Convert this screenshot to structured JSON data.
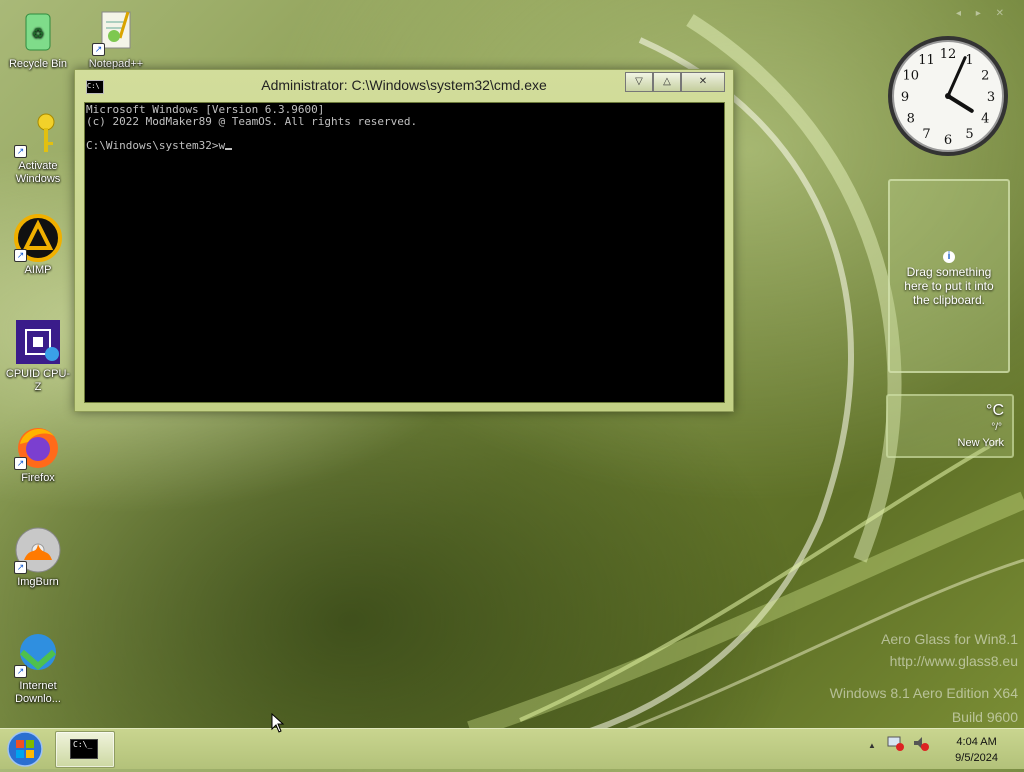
{
  "desktop_icons": [
    {
      "label": "Recycle Bin",
      "icon": "recycle-bin-icon"
    },
    {
      "label": "Notepad++",
      "icon": "notepad-plus-plus-icon"
    },
    {
      "label": "Activate Windows",
      "icon": "key-icon"
    },
    {
      "label": "AIMP",
      "icon": "aimp-icon"
    },
    {
      "label": "CPUID CPU-Z",
      "icon": "cpu-z-icon"
    },
    {
      "label": "Firefox",
      "icon": "firefox-icon"
    },
    {
      "label": "ImgBurn",
      "icon": "imgburn-icon"
    },
    {
      "label": "Internet Downlo...",
      "icon": "internet-download-manager-icon"
    }
  ],
  "cmd_window": {
    "title": "Administrator: C:\\Windows\\system32\\cmd.exe",
    "minimize_glyph": "▽",
    "maximize_glyph": "△",
    "close_glyph": "✕",
    "lines": [
      "Microsoft Windows [Version 6.3.9600]",
      "(c) 2022 ModMaker89 @ TeamOS. All rights reserved.",
      "",
      "C:\\Windows\\system32>w"
    ]
  },
  "clock_gadget": {
    "hour": 4,
    "minute": 4,
    "numerals": [
      "12",
      "1",
      "2",
      "3",
      "4",
      "5",
      "6",
      "7",
      "8",
      "9",
      "10",
      "11"
    ]
  },
  "clipboard_gadget": {
    "info_glyph": "i",
    "text": "Drag something here to put it into the clipboard."
  },
  "weather_gadget": {
    "temperature": "°C",
    "high_low": "°/°",
    "city": "New York"
  },
  "watermark": {
    "line1": "Aero Glass for Win8.1",
    "line2": "http://www.glass8.eu",
    "line3": "Windows 8.1 Aero Edition X64",
    "line4": "Build 9600"
  },
  "taskbar": {
    "cmd_button_text": "C:\\_",
    "tray_arrow": "▲",
    "time": "4:04 AM",
    "date": "9/5/2024"
  },
  "colors": {
    "accent": "#b8c67e",
    "console_bg": "#000000",
    "console_text": "#c0c0c0"
  }
}
